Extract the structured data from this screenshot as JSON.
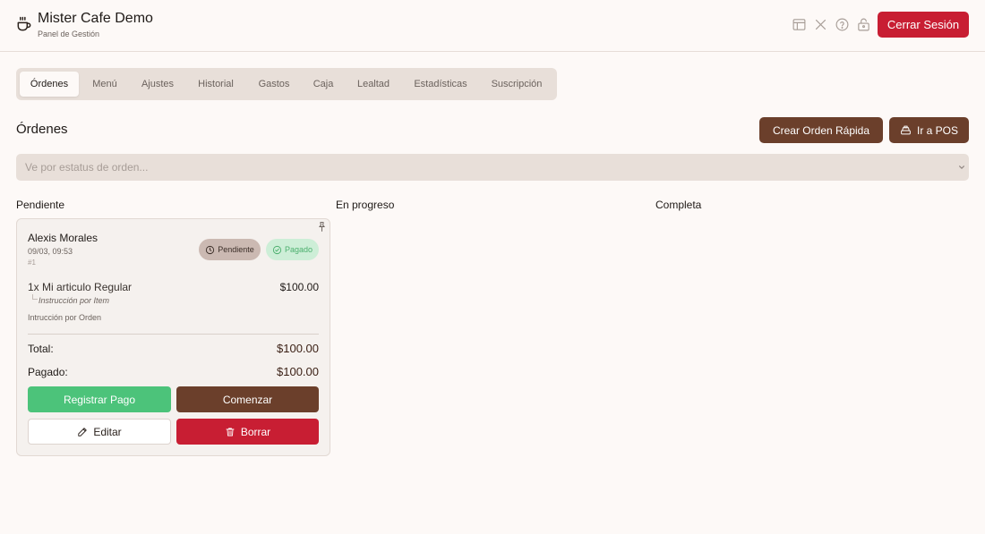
{
  "header": {
    "title": "Mister Cafe Demo",
    "subtitle": "Panel de Gestión",
    "icons": [
      "layout-icon",
      "close-icon",
      "help-icon",
      "lock-icon"
    ],
    "logout_label": "Cerrar Sesión"
  },
  "tabs": [
    {
      "label": "Órdenes",
      "active": true
    },
    {
      "label": "Menú",
      "active": false
    },
    {
      "label": "Ajustes",
      "active": false
    },
    {
      "label": "Historial",
      "active": false
    },
    {
      "label": "Gastos",
      "active": false
    },
    {
      "label": "Caja",
      "active": false
    },
    {
      "label": "Lealtad",
      "active": false
    },
    {
      "label": "Estadísticas",
      "active": false
    },
    {
      "label": "Suscripción",
      "active": false
    }
  ],
  "main": {
    "title": "Órdenes",
    "quick_order_label": "Crear Orden Rápida",
    "pos_label": "Ir a POS",
    "status_filter_placeholder": "Ve por estatus de orden..."
  },
  "columns": [
    "Pendiente",
    "En progreso",
    "Completa"
  ],
  "order": {
    "customer": "Alexis Morales",
    "datetime": "09/03, 09:53",
    "number": "#1",
    "status_badge": "Pendiente",
    "payment_badge": "Pagado",
    "items": [
      {
        "name": "1x Mi articulo Regular",
        "price": "$100.00",
        "instruction": "Instrucción por Item"
      }
    ],
    "order_instruction": "Intrucción por Orden",
    "total_label": "Total:",
    "total_value": "$100.00",
    "paid_label": "Pagado:",
    "paid_value": "$100.00",
    "register_payment_label": "Registrar Pago",
    "start_label": "Comenzar",
    "edit_label": "Editar",
    "delete_label": "Borrar"
  },
  "colors": {
    "brand_brown": "#6b3f2b",
    "danger_red": "#c81e33",
    "success_green": "#4cc37a",
    "background": "#fdf9f7"
  }
}
